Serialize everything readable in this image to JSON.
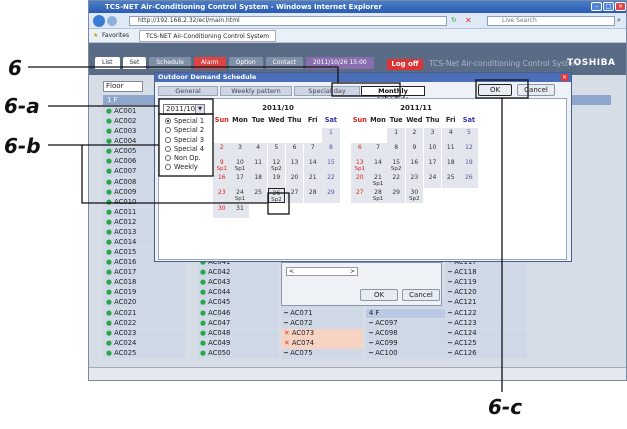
{
  "browser": {
    "title": "TCS-NET Air-Conditioning Control System - Windows Internet Explorer",
    "url": "http://192.168.2.32/ecl/main.html",
    "search_placeholder": "Live Search",
    "favorites_label": "Favorites",
    "fav_tab": "TCS-NET Air-Conditioning Control System"
  },
  "app": {
    "tabs": [
      "List",
      "Set",
      "Schedule",
      "Alarm",
      "Option",
      "Contact",
      "2011/10/26 15:00"
    ],
    "logoff": "Log off",
    "brand": "TCS-Net Air-conditioning Control System",
    "logo": "TOSHIBA",
    "floor_label": "Floor",
    "floor_header": "1 F"
  },
  "units": {
    "col1": [
      "AC001",
      "AC002",
      "AC003",
      "AC004",
      "AC005",
      "AC006",
      "AC007",
      "AC008",
      "AC009",
      "AC010",
      "AC011",
      "AC012",
      "AC013",
      "AC014",
      "AC015",
      "AC016",
      "AC017",
      "AC018",
      "AC019",
      "AC020",
      "AC021",
      "AC022",
      "AC023",
      "AC024",
      "AC025"
    ],
    "col2": [
      "AC039",
      "AC040",
      "AC041",
      "AC042",
      "AC043",
      "AC044",
      "AC045",
      "AC046",
      "AC047",
      "AC048",
      "AC049",
      "AC050"
    ],
    "col3": [
      "AC070",
      "AC071",
      "AC072",
      "AC073",
      "AC074",
      "AC075"
    ],
    "col4": [
      "AC096",
      "4 F",
      "AC097",
      "AC098",
      "AC099",
      "AC100"
    ],
    "col5": [
      "AC115",
      "AC116",
      "AC117",
      "AC118",
      "AC119",
      "AC120",
      "AC121",
      "AC122",
      "AC123",
      "AC124",
      "AC125",
      "AC126"
    ]
  },
  "dialog": {
    "title": "Outdoor Demand Schedule",
    "tabs": [
      "General",
      "Weekly pattern",
      "Special day",
      "Monthly schedule"
    ],
    "ok": "OK",
    "cancel": "Cancel",
    "year_month": "2011/10",
    "radios": [
      "Special 1",
      "Special 2",
      "Special 3",
      "Special 4",
      "Non Op.",
      "Weekly"
    ],
    "weekdays": [
      "Sun",
      "Mon",
      "Tue",
      "Wed",
      "Thu",
      "Fri",
      "Sat"
    ],
    "cal1": {
      "title": "2011/10",
      "days": [
        [
          "",
          "",
          ""
        ],
        [
          "",
          "",
          ""
        ],
        [
          "",
          "",
          ""
        ],
        [
          "",
          "",
          ""
        ],
        [
          "",
          "",
          ""
        ],
        [
          "",
          "",
          ""
        ],
        [
          "1",
          "",
          "sat"
        ],
        [
          "2",
          "",
          "sun"
        ],
        [
          "3",
          "",
          ""
        ],
        [
          "4",
          "",
          ""
        ],
        [
          "5",
          "",
          ""
        ],
        [
          "6",
          "",
          ""
        ],
        [
          "7",
          "",
          ""
        ],
        [
          "8",
          "",
          "sat"
        ],
        [
          "9",
          "Sp1",
          "sun"
        ],
        [
          "10",
          "Sp1",
          ""
        ],
        [
          "11",
          "",
          ""
        ],
        [
          "12",
          "Sp2",
          ""
        ],
        [
          "13",
          "",
          ""
        ],
        [
          "14",
          "",
          ""
        ],
        [
          "15",
          "",
          "sat"
        ],
        [
          "16",
          "",
          "sun"
        ],
        [
          "17",
          "",
          ""
        ],
        [
          "18",
          "",
          ""
        ],
        [
          "19",
          "",
          ""
        ],
        [
          "20",
          "",
          ""
        ],
        [
          "21",
          "",
          ""
        ],
        [
          "22",
          "",
          "sat"
        ],
        [
          "23",
          "",
          "sun"
        ],
        [
          "24",
          "Sp1",
          ""
        ],
        [
          "25",
          "",
          ""
        ],
        [
          "26",
          "Sp2",
          "sel"
        ],
        [
          "27",
          "",
          ""
        ],
        [
          "28",
          "",
          ""
        ],
        [
          "29",
          "",
          "sat"
        ],
        [
          "30",
          "",
          "sun"
        ],
        [
          "31",
          "",
          ""
        ]
      ]
    },
    "cal2": {
      "title": "2011/11",
      "days": [
        [
          "",
          "",
          ""
        ],
        [
          "",
          "",
          ""
        ],
        [
          "1",
          "",
          ""
        ],
        [
          "2",
          "",
          ""
        ],
        [
          "3",
          "",
          ""
        ],
        [
          "4",
          "",
          ""
        ],
        [
          "5",
          "",
          "sat"
        ],
        [
          "6",
          "",
          "sun"
        ],
        [
          "7",
          "",
          ""
        ],
        [
          "8",
          "",
          ""
        ],
        [
          "9",
          "",
          ""
        ],
        [
          "10",
          "",
          ""
        ],
        [
          "11",
          "",
          ""
        ],
        [
          "12",
          "",
          "sat"
        ],
        [
          "13",
          "Sp1",
          "sun"
        ],
        [
          "14",
          "",
          ""
        ],
        [
          "15",
          "Sp2",
          ""
        ],
        [
          "16",
          "",
          ""
        ],
        [
          "17",
          "",
          ""
        ],
        [
          "18",
          "",
          ""
        ],
        [
          "19",
          "",
          "sat"
        ],
        [
          "20",
          "",
          "sun"
        ],
        [
          "21",
          "Sp1",
          ""
        ],
        [
          "22",
          "",
          ""
        ],
        [
          "23",
          "",
          ""
        ],
        [
          "24",
          "",
          ""
        ],
        [
          "25",
          "",
          ""
        ],
        [
          "26",
          "",
          "sat"
        ],
        [
          "27",
          "",
          "sun"
        ],
        [
          "28",
          "Sp1",
          ""
        ],
        [
          "29",
          "",
          ""
        ],
        [
          "30",
          "Sp2",
          ""
        ]
      ]
    }
  },
  "dialog2": {
    "ok": "OK",
    "cancel": "Cancel"
  },
  "annotations": {
    "a6": "6",
    "a6a": "6-a",
    "a6b": "6-b",
    "a6c": "6-c"
  }
}
